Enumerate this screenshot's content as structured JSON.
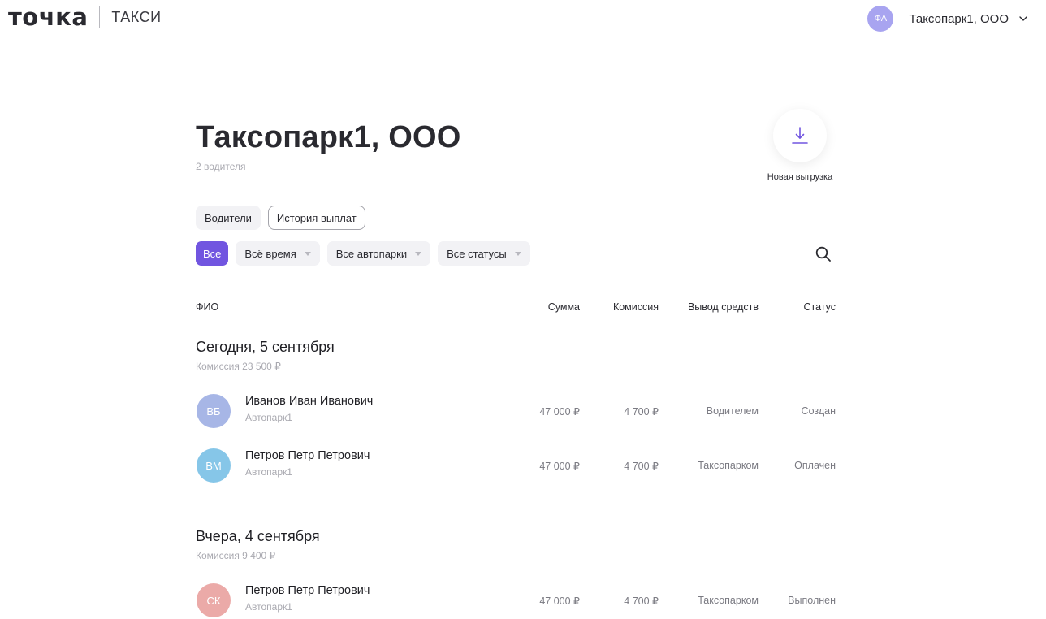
{
  "header": {
    "logo": "точка",
    "product": "ТАКСИ",
    "account": {
      "initials": "ФА",
      "name": "Таксопарк1, ООО",
      "avatar_color": "#a8a4f0"
    }
  },
  "page": {
    "title": "Таксопарк1, ООО",
    "subtitle": "2 водителя",
    "export_label": "Новая выгрузка"
  },
  "tabs": [
    {
      "label": "Водители",
      "active": false
    },
    {
      "label": "История выплат",
      "active": true
    }
  ],
  "filters": {
    "all_label": "Все",
    "period": "Всё время",
    "parks": "Все автопарки",
    "statuses": "Все статусы"
  },
  "table": {
    "columns": [
      "ФИО",
      "Сумма",
      "Комиссия",
      "Вывод средств",
      "Статус"
    ],
    "groups": [
      {
        "title": "Сегодня, 5 сентября",
        "commission": "Комиссия 23 500 ₽",
        "rows": [
          {
            "initials": "ВБ",
            "avatar_color": "#a7b6e6",
            "name": "Иванов Иван Иванович",
            "park": "Автопарк1",
            "sum": "47 000 ₽",
            "fee": "4 700 ₽",
            "withdrawal": "Водителем",
            "status": "Создан"
          },
          {
            "initials": "ВМ",
            "avatar_color": "#86c6e8",
            "name": "Петров Петр Петрович",
            "park": "Автопарк1",
            "sum": "47 000 ₽",
            "fee": "4 700 ₽",
            "withdrawal": "Таксопарком",
            "status": "Оплачен"
          }
        ]
      },
      {
        "title": "Вчера, 4 сентября",
        "commission": "Комиссия 9 400 ₽",
        "rows": [
          {
            "initials": "СК",
            "avatar_color": "#ebaaa8",
            "name": "Петров Петр Петрович",
            "park": "Автопарк1",
            "sum": "47 000 ₽",
            "fee": "4 700 ₽",
            "withdrawal": "Таксопарком",
            "status": "Выполнен"
          }
        ]
      }
    ]
  },
  "colors": {
    "accent": "#7155e0",
    "muted_text": "#a9a9b0",
    "chip_bg": "#f2f2f5"
  }
}
